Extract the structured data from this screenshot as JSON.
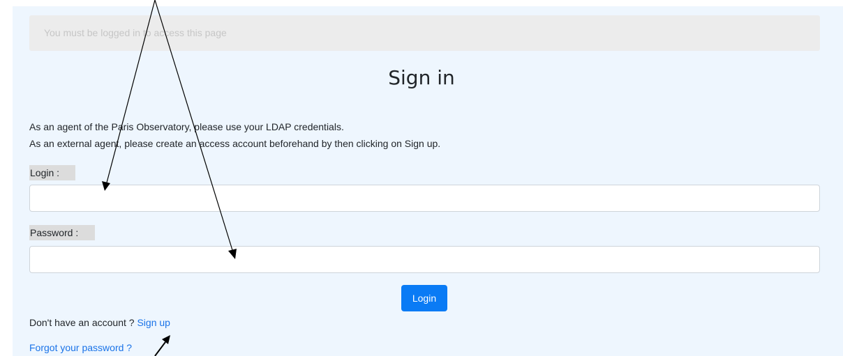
{
  "alert": {
    "message": "You must be logged in to access this page"
  },
  "page": {
    "title": "Sign in",
    "intro_line_1": "As an agent of the Paris Observatory, please use your LDAP credentials.",
    "intro_line_2": "As an external agent, please create an access account beforehand by then clicking on Sign up."
  },
  "form": {
    "login_label": "Login :",
    "login_value": "",
    "password_label": "Password :",
    "password_value": "",
    "submit_label": "Login"
  },
  "links": {
    "no_account_text": "Don't have an account ?",
    "sign_up_label": "Sign up",
    "forgot_password_label": "Forgot your password ?"
  },
  "colors": {
    "panel_background": "#eef6fe",
    "primary_button": "#0a7bf5",
    "link": "#1a73e8",
    "annotation_arrow": "#000000"
  }
}
